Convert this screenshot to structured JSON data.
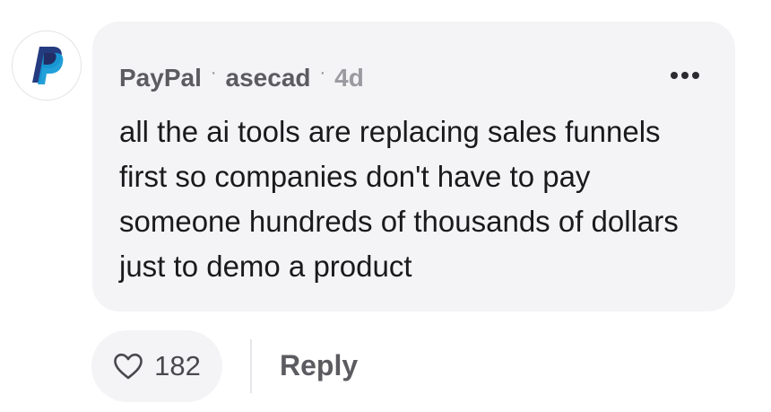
{
  "comment": {
    "author": "PayPal",
    "username": "asecad",
    "separator": "·",
    "time": "4d",
    "text": "all the ai tools are replacing sales funnels first so companies don't have to pay someone hundreds of thousands of dollars just to demo a product",
    "likes": "182",
    "reply_label": "Reply",
    "avatar_icon": "paypal-logo-icon",
    "more_icon": "more-options-icon",
    "like_icon": "heart-outline-icon"
  },
  "colors": {
    "bubble_bg": "#f4f4f6",
    "paypal_dark": "#253b80",
    "paypal_light": "#179bd7"
  }
}
